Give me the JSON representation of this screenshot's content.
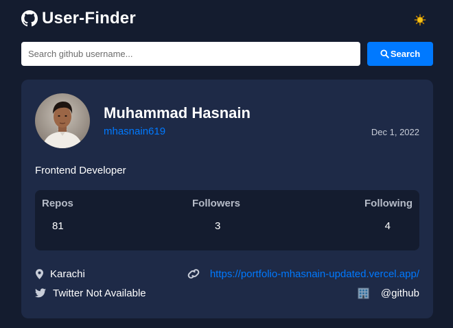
{
  "header": {
    "title": "User-Finder",
    "brand_icon": "github-icon",
    "theme_icon": "sun-icon"
  },
  "search": {
    "placeholder": "Search github username...",
    "value": "",
    "button_label": "Search",
    "button_icon": "search-icon"
  },
  "profile": {
    "name": "Muhammad Hasnain",
    "login": "mhasnain619",
    "joined": "Dec 1, 2022",
    "bio": "Frontend Developer"
  },
  "stats": {
    "repos_label": "Repos",
    "repos_value": "81",
    "followers_label": "Followers",
    "followers_value": "3",
    "following_label": "Following",
    "following_value": "4"
  },
  "info": {
    "location": "Karachi",
    "twitter": "Twitter Not Available",
    "website": "https://portfolio-mhasnain-updated.vercel.app/",
    "company": "@github"
  },
  "colors": {
    "background": "#141c2f",
    "card": "#1e2a47",
    "accent": "#0079ff",
    "text": "#ffffff",
    "muted": "#b6bcc8"
  }
}
